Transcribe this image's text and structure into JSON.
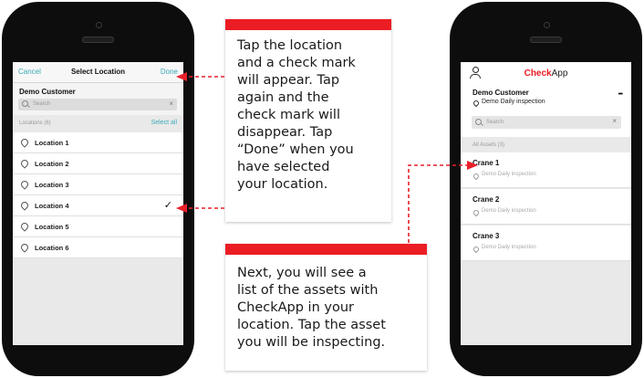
{
  "left_phone": {
    "header": {
      "cancel": "Cancel",
      "title": "Select Location",
      "done": "Done"
    },
    "customer": "Demo Customer",
    "search_placeholder": "Search",
    "clear_icon": "close-icon",
    "list_header": {
      "count_label": "Locations (6)",
      "select_all": "Select all"
    },
    "locations": [
      {
        "label": "Location 1",
        "checked": false
      },
      {
        "label": "Location 2",
        "checked": false
      },
      {
        "label": "Location 3",
        "checked": false
      },
      {
        "label": "Location 4",
        "checked": true
      },
      {
        "label": "Location 5",
        "checked": false
      },
      {
        "label": "Location 6",
        "checked": false
      }
    ]
  },
  "right_phone": {
    "app_name_brand": "Check",
    "app_name_rest": "App",
    "customer": "Demo Customer",
    "inspection": "Demo Daily inspection",
    "more": "•••",
    "search_placeholder": "Search",
    "list_header": "All Assets (3)",
    "assets": [
      {
        "name": "Crane 1",
        "subtitle": "Demo Daily inspection"
      },
      {
        "name": "Crane 2",
        "subtitle": "Demo Daily inspection"
      },
      {
        "name": "Crane 3",
        "subtitle": "Demo Daily inspection"
      }
    ]
  },
  "callouts": {
    "top": "Tap the location\nand a check mark\nwill appear. Tap\nagain and the\ncheck mark will\ndisappear. Tap\n“Done” when you\nhave selected\nyour location.",
    "bottom": "Next, you will see a\nlist of the assets with\nCheckApp in your\nlocation. Tap the asset\nyou will be inspecting."
  },
  "colors": {
    "accent_teal": "#3aa9b7",
    "brand_red": "#ec1c24",
    "arrow_red": "#e8202a",
    "phone_body": "#0d0d0d"
  }
}
